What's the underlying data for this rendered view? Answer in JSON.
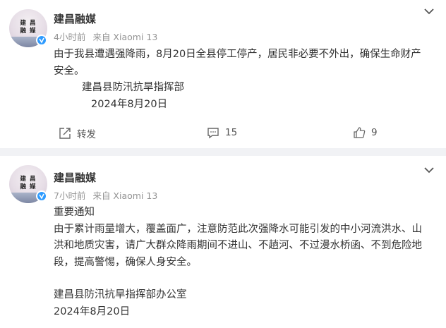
{
  "posts": [
    {
      "author": "建昌融媒",
      "avatar_text": [
        "建 昌",
        "融 媒"
      ],
      "time": "4小时前",
      "source": "来自 Xiaomi 13",
      "content": [
        "由于我县遭遇强降雨，8月20日全县停工停产，居民非必要不外出，确保生命财产",
        "安全。",
        "建昌县防汛抗旱指挥部",
        "2024年8月20日"
      ],
      "actions": {
        "repost_label": "转发",
        "comment_count": "15",
        "like_count": "9"
      }
    },
    {
      "author": "建昌融媒",
      "avatar_text": [
        "建 昌",
        "融 媒"
      ],
      "time": "7小时前",
      "source": "来自 Xiaomi 13",
      "content": [
        "重要通知",
        "由于累计雨量增大，覆盖面广，注意防范此次强降水可能引发的中小河流洪水、山",
        "洪和地质灾害，请广大群众降雨期间不进山、不趟河、不过漫水桥函、不到危险地",
        "段，提高警惕，确保人身安全。",
        "建昌县防汛抗旱指挥部办公室",
        "2024年8月20日"
      ]
    }
  ],
  "colors": {
    "badge": "#2e9bff",
    "meta_text": "#939393",
    "divider": "#f1f2f5"
  },
  "icons": [
    "verified-badge-icon",
    "chevron-down-icon",
    "repost-icon",
    "comment-icon",
    "like-icon"
  ]
}
